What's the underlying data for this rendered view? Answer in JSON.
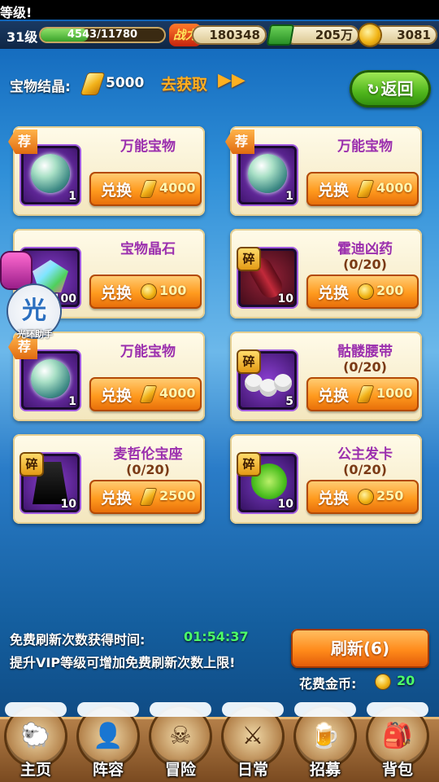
{
  "ticker": {
    "text": "等级!"
  },
  "status": {
    "level": "31级",
    "exp_text": "4543/11780",
    "exp_fraction": 0.386,
    "power_label": "战力",
    "power": "180348",
    "money": "205万",
    "gold": "3081"
  },
  "crystal": {
    "label": "宝物结晶:",
    "value": "5000",
    "get_link": "去获取",
    "get_arrow": "▶▶"
  },
  "back_button": {
    "label": "返回",
    "arrow": "↻"
  },
  "exchange_label": "兑换",
  "cards": [
    {
      "name": "万能宝物",
      "progress": "",
      "qty": "1",
      "price": "4000",
      "currency": "crystal",
      "tag": "荐"
    },
    {
      "name": "万能宝物",
      "progress": "",
      "qty": "1",
      "price": "4000",
      "currency": "crystal",
      "tag": "荐"
    },
    {
      "name": "宝物晶石",
      "progress": "",
      "qty": "100",
      "price": "100",
      "currency": "gold",
      "tag": ""
    },
    {
      "name": "霍迪凶药",
      "progress": "(0/20)",
      "qty": "10",
      "price": "200",
      "currency": "gold",
      "tag": "碎"
    },
    {
      "name": "万能宝物",
      "progress": "",
      "qty": "1",
      "price": "4000",
      "currency": "crystal",
      "tag": "荐"
    },
    {
      "name": "骷髅腰带",
      "progress": "(0/20)",
      "qty": "5",
      "price": "1000",
      "currency": "crystal",
      "tag": "碎"
    },
    {
      "name": "麦哲伦宝座",
      "progress": "(0/20)",
      "qty": "10",
      "price": "2500",
      "currency": "crystal",
      "tag": "碎"
    },
    {
      "name": "公主发卡",
      "progress": "(0/20)",
      "qty": "10",
      "price": "250",
      "currency": "gold",
      "tag": "碎"
    }
  ],
  "refresh": {
    "time_label": "免费刷新次数获得时间:",
    "time_value": "01:54:37",
    "vip_tip": "提升VIP等级可增加免费刷新次数上限!",
    "button_label": "刷新(6)",
    "cost_label": "花费金币:",
    "cost_value": "20"
  },
  "assistant": {
    "char": "光",
    "text": "光环助手"
  },
  "nav": [
    {
      "label": "主页",
      "icon": "sheep-icon"
    },
    {
      "label": "阵容",
      "icon": "lineup-icon"
    },
    {
      "label": "冒险",
      "icon": "skull-flag-icon"
    },
    {
      "label": "日常",
      "icon": "crossed-swords-icon"
    },
    {
      "label": "招募",
      "icon": "bar-sign-icon"
    },
    {
      "label": "背包",
      "icon": "backpack-icon"
    }
  ],
  "colors": {
    "accent_orange": "#ff9a1e",
    "name_purple": "#9b2fae",
    "timer_green": "#4cff6a"
  }
}
